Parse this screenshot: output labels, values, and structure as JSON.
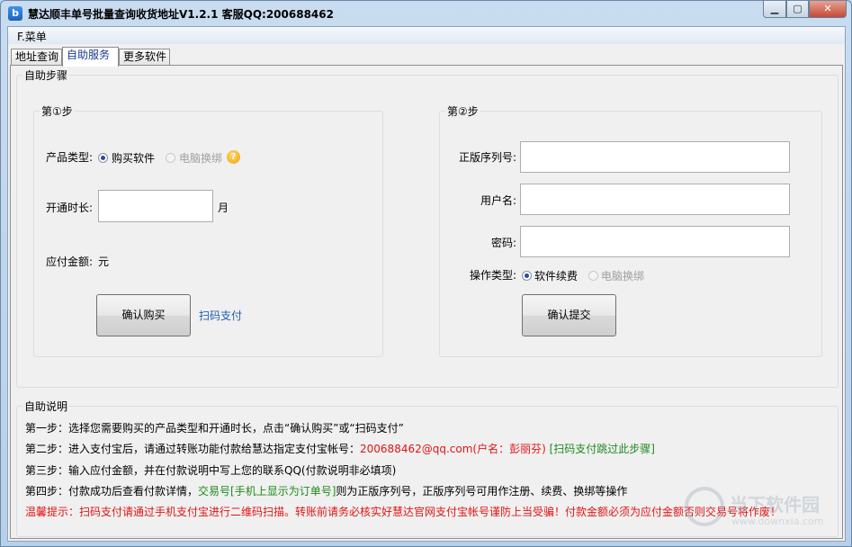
{
  "window": {
    "title": "慧达顺丰单号批量查询收货地址V1.2.1 客服QQ:200688462",
    "icon_letter": "b"
  },
  "menu": {
    "items": [
      {
        "label": "F.菜单"
      }
    ]
  },
  "tabs": [
    {
      "label": "地址查询"
    },
    {
      "label": "自助服务",
      "active": true
    },
    {
      "label": "更多软件"
    }
  ],
  "steps_group": {
    "title": "自助步骤",
    "step1": {
      "title": "第①步",
      "product_type_label": "产品类型:",
      "option_buy": "购买软件",
      "option_rebind": "电脑换绑",
      "duration_label": "开通时长:",
      "duration_value": "",
      "duration_unit": "月",
      "amount_label": "应付金额:",
      "amount_unit": "元",
      "confirm_buy_button": "确认购买",
      "scan_pay_link": "扫码支付"
    },
    "step2": {
      "title": "第②步",
      "serial_label": "正版序列号:",
      "serial_value": "",
      "username_label": "用户名:",
      "username_value": "",
      "password_label": "密码:",
      "password_value": "",
      "op_type_label": "操作类型:",
      "option_renew": "软件续费",
      "option_rebind": "电脑换绑",
      "submit_button": "确认提交"
    }
  },
  "help_group": {
    "title": "自助说明",
    "line1": "第一步：选择您需要购买的产品类型和开通时长，点击“确认购买”或“扫码支付”",
    "line2_prefix": "第二步：进入支付宝后，请通过转账功能付款给慧达指定支付宝帐号：",
    "line2_account": "200688462@qq.com(户名：彭丽芬)",
    "line2_suffix": "[扫码支付跳过此步骤]",
    "line3": "第三步：输入应付金额，并在付款说明中写上您的联系QQ(付款说明非必填项)",
    "line4_prefix": "第四步：付款成功后查看付款详情，",
    "line4_highlight": "交易号[手机上显示为订单号]",
    "line4_suffix": "则为正版序列号，正版序列号可用作注册、续费、换绑等操作",
    "warning": "温馨提示：扫码支付请通过手机支付宝进行二维码扫描。转账前请务必核实好慧达官网支付宝帐号谨防上当受骗！付款金额必须为应付金额否则交易号将作废！"
  },
  "watermark": {
    "text": "当下软件园",
    "url": "www.downxia.com"
  },
  "colors": {
    "accent_link": "#1c5fb5",
    "green": "#1e8a1e",
    "warning_red": "#e31313"
  }
}
